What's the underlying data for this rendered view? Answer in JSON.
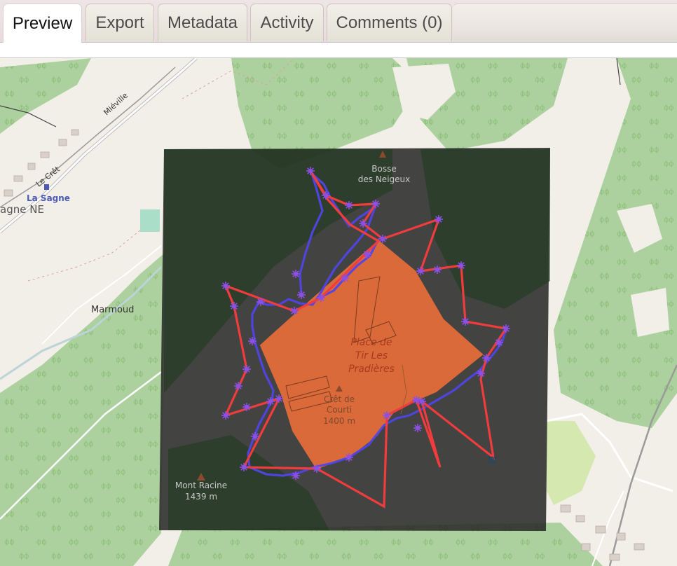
{
  "tabs": [
    {
      "label": "Preview",
      "active": true
    },
    {
      "label": "Export",
      "active": false
    },
    {
      "label": "Metadata",
      "active": false
    },
    {
      "label": "Activity",
      "active": false
    },
    {
      "label": "Comments (0)",
      "active": false
    }
  ],
  "map": {
    "labels": {
      "mieville": "Miéville",
      "le_cret": "Le Crêt",
      "la_sagne": "La Sagne",
      "sagne_ne": "agne NE",
      "marmoud": "Marmoud",
      "bosse_1": "Bosse",
      "bosse_2": "des Neigeux",
      "place_1": "Place de",
      "place_2": "Tir Les",
      "place_3": "Pradières",
      "cret_1": "Crêt de",
      "cret_2": "Courti",
      "cret_3": "1400 m",
      "racine_1": "Mont Racine",
      "racine_2": "1439 m"
    },
    "colors": {
      "background": "#f2efe9",
      "forest": "#add19e",
      "overlay": "#262626",
      "polygon_fill": "#f0703a",
      "route_red": "#f03c3c",
      "route_blue": "#5046e6",
      "marker": "#8c50e6"
    }
  }
}
